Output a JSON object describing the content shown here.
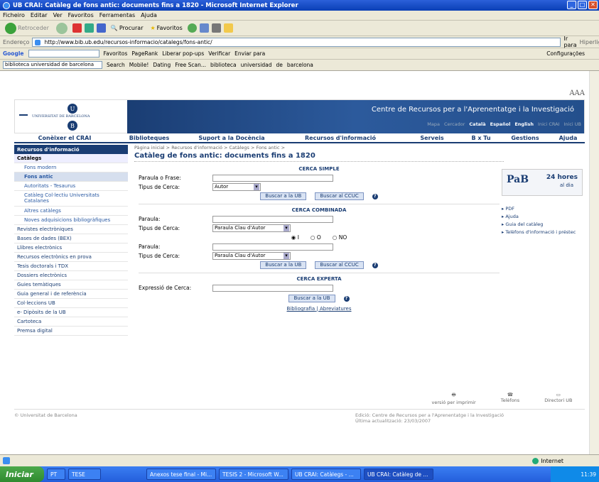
{
  "window": {
    "title": "UB CRAI: Catàleg de fons antic: documents fins a 1820 - Microsoft Internet Explorer"
  },
  "menu": [
    "Ficheiro",
    "Editar",
    "Ver",
    "Favoritos",
    "Ferramentas",
    "Ajuda"
  ],
  "toolbar": {
    "back": "Retroceder",
    "search": "Procurar",
    "favorites": "Favoritos"
  },
  "address": {
    "label": "Endereço",
    "url": "http://www.bib.ub.edu/recursos-informacio/catalegs/fons-antic/",
    "go": "Ir para",
    "links": "Hiperligações"
  },
  "google": {
    "label": "Google",
    "items": [
      "Favoritos",
      "PageRank",
      "Liberar pop-ups",
      "Verificar",
      "Enviar para"
    ],
    "settings": "Configurações"
  },
  "linksbar": {
    "field": "biblioteca universidad de barcelona",
    "search": "Search",
    "items": [
      "Mobile!",
      "Dating",
      "Free Scan...",
      "biblioteca",
      "universidad",
      "de",
      "barcelona"
    ]
  },
  "page": {
    "aaa": "AAA",
    "site_title": "Centre de Recursos per a l'Aprenentatge i la Investigació",
    "university": "UNIVERSITAT DE BARCELONA",
    "sublinks": [
      "Mapa",
      "Cercador",
      "Català",
      "Español",
      "English",
      "Inici CRAI",
      "Inici UB"
    ],
    "nav": [
      "Conèixer el CRAI",
      "Biblioteques",
      "Suport a la Docència",
      "Recursos d'informació",
      "Serveis",
      "B x Tu",
      "Gestions",
      "Ajuda"
    ],
    "leftnav": {
      "header": "Recursos d'informació",
      "items": [
        {
          "label": "Catàlegs",
          "type": "cat"
        },
        {
          "label": "Fons modern",
          "type": "sub"
        },
        {
          "label": "Fons antic",
          "type": "sel"
        },
        {
          "label": "Autoritats - Tesaurus",
          "type": "sub"
        },
        {
          "label": "Catàleg Col·lectiu Universitats Catalanes",
          "type": "sub"
        },
        {
          "label": "Altres catàlegs",
          "type": "sub"
        },
        {
          "label": "Noves adquisicions bibliogràfiques",
          "type": "sub"
        },
        {
          "label": "Revistes electròniques",
          "type": "top"
        },
        {
          "label": "Bases de dades (BEX)",
          "type": "top"
        },
        {
          "label": "Llibres electrònics",
          "type": "top"
        },
        {
          "label": "Recursos electrònics en prova",
          "type": "top"
        },
        {
          "label": "Tesis doctorals i TDX",
          "type": "top"
        },
        {
          "label": "Dossiers electrònics",
          "type": "top"
        },
        {
          "label": "Guies temàtiques",
          "type": "top"
        },
        {
          "label": "Guia general i de referència",
          "type": "top"
        },
        {
          "label": "Col·leccions UB",
          "type": "top"
        },
        {
          "label": "e- Dipòsits de la UB",
          "type": "top"
        },
        {
          "label": "Cartoteca",
          "type": "top"
        },
        {
          "label": "Premsa digital",
          "type": "top"
        }
      ]
    },
    "breadcrumb": "Pàgina inicial > Recursos d'informació > Catàlegs > Fons antic >",
    "heading": "Catàleg de fons antic: documents fins a 1820",
    "simple": {
      "title": "CERCA SIMPLE",
      "phrase_label": "Paraula o Frase:",
      "type_label": "Tipus de Cerca:",
      "type_value": "Autor",
      "btn_ub": "Buscar a la UB",
      "btn_ccuc": "Buscar al CCUC"
    },
    "combined": {
      "title": "CERCA COMBINADA",
      "word_label": "Paraula:",
      "type_label": "Tipus de Cerca:",
      "type_value": "Paraula Clau d'Autor",
      "op_i": "I",
      "op_o": "O",
      "op_no": "NO",
      "word2_label": "Paraula:",
      "type2_label": "Tipus de Cerca:",
      "type2_value": "Paraula Clau d'Autor",
      "btn_ub": "Buscar a la UB",
      "btn_ccuc": "Buscar al CCUC"
    },
    "expert": {
      "title": "CERCA EXPERTA",
      "expr_label": "Expressió de Cerca:",
      "btn_ub": "Buscar a la UB"
    },
    "links": {
      "bib": "Bibliografia",
      "abbr": "Abreviatures"
    },
    "rightbox": {
      "logo": "PaB",
      "hours": "24 hores",
      "day": "al dia"
    },
    "rightlinks": [
      "PDF",
      "Ajuda",
      "Guia del catàleg",
      "Telèfons d'informació i préstec"
    ],
    "footer_icons": [
      "versió per imprimir",
      "Telèfons",
      "Directori UB"
    ],
    "footer_left": "© Universitat de Barcelona",
    "footer_right1": "Edició: Centre de Recursos per a l'Aprenentatge i la Investigació",
    "footer_right2": "Última actualització: 23/03/2007"
  },
  "status": {
    "zone": "Internet"
  },
  "taskbar": {
    "start": "Iniciar",
    "items": [
      "PT",
      "TESE",
      "Anexos tese final - Mi...",
      "TESIS 2 - Microsoft W...",
      "UB CRAI: Catàlegs - ...",
      "UB CRAI: Catàleg de ..."
    ],
    "time": "11:39"
  }
}
